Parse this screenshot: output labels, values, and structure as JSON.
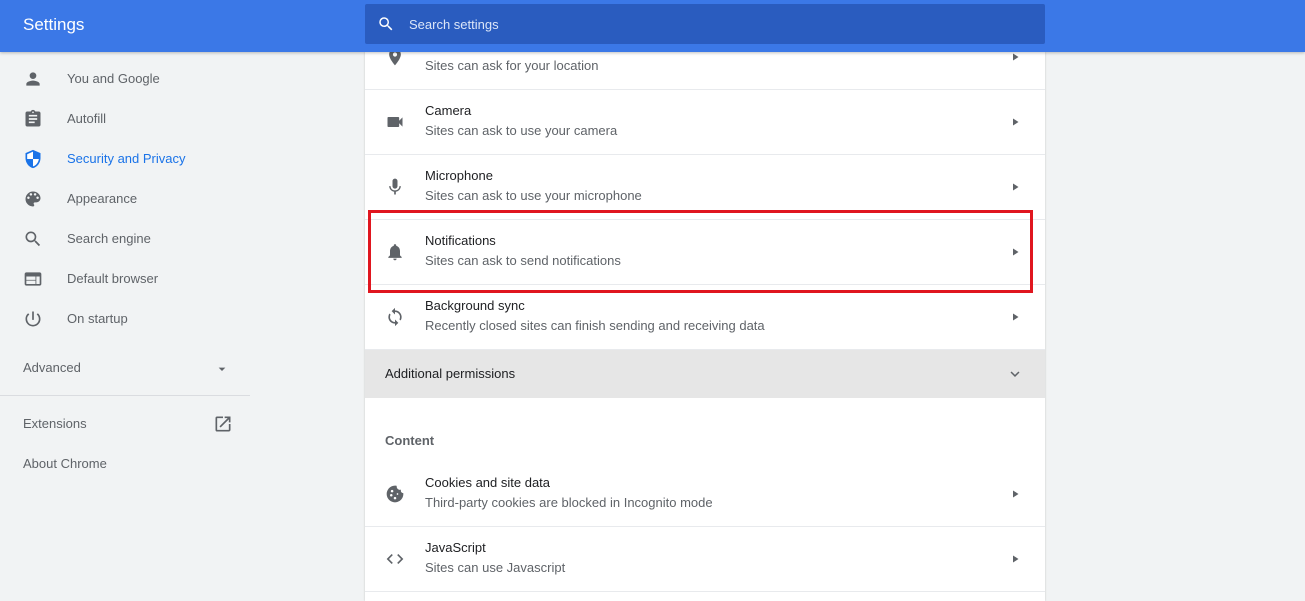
{
  "header": {
    "title": "Settings",
    "search_placeholder": "Search settings",
    "color": "#3b78e7"
  },
  "sidebar": {
    "items": [
      {
        "label": "You and Google",
        "icon": "person-icon"
      },
      {
        "label": "Autofill",
        "icon": "clipboard-icon"
      },
      {
        "label": "Security and Privacy",
        "icon": "shield-icon",
        "active": true
      },
      {
        "label": "Appearance",
        "icon": "palette-icon"
      },
      {
        "label": "Search engine",
        "icon": "search-icon"
      },
      {
        "label": "Default browser",
        "icon": "browser-window-icon"
      },
      {
        "label": "On startup",
        "icon": "power-icon"
      }
    ],
    "advanced_label": "Advanced",
    "extensions_label": "Extensions",
    "about_label": "About Chrome"
  },
  "main": {
    "rows": [
      {
        "title": "",
        "subtitle": "Sites can ask for your location",
        "icon": "location-pin-icon"
      },
      {
        "title": "Camera",
        "subtitle": "Sites can ask to use your camera",
        "icon": "camera-icon"
      },
      {
        "title": "Microphone",
        "subtitle": "Sites can ask to use your microphone",
        "icon": "microphone-icon"
      },
      {
        "title": "Notifications",
        "subtitle": "Sites can ask to send notifications",
        "icon": "bell-icon"
      },
      {
        "title": "Background sync",
        "subtitle": "Recently closed sites can finish sending and receiving data",
        "icon": "sync-icon"
      }
    ],
    "additional_permissions_label": "Additional permissions",
    "content_section_title": "Content",
    "content_rows": [
      {
        "title": "Cookies and site data",
        "subtitle": "Third-party cookies are blocked in Incognito mode",
        "icon": "cookie-icon"
      },
      {
        "title": "JavaScript",
        "subtitle": "Sites can use Javascript",
        "icon": "code-brackets-icon"
      }
    ]
  },
  "colors": {
    "accent": "#1a73e8",
    "highlight_border": "#e0161f"
  }
}
